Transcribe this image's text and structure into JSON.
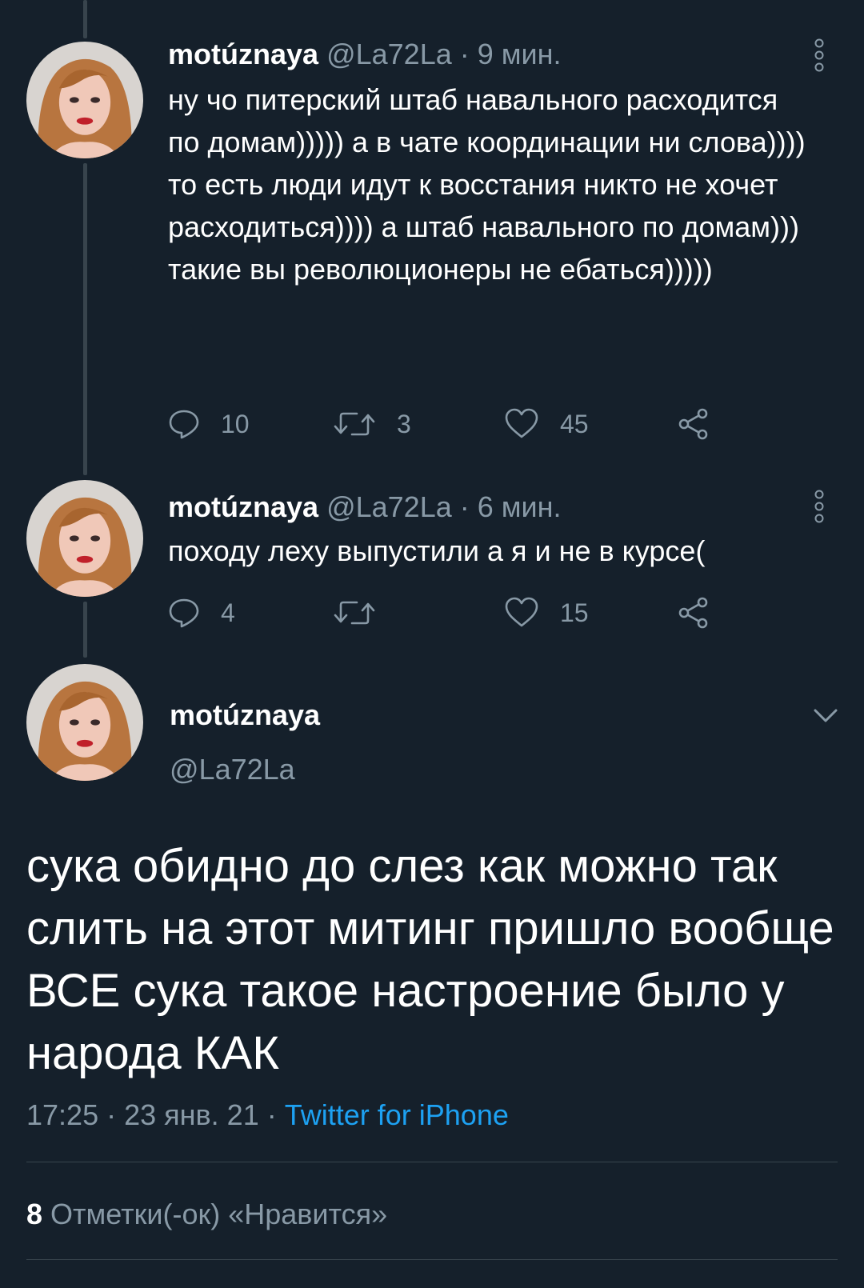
{
  "tweets": [
    {
      "name": "motúznaya",
      "handle": "@La72La",
      "separator": "·",
      "time": "9 мин.",
      "text": "ну чо питерский штаб навального расходится по домам))))) а в чате координации ни слова)))) то есть люди идут к восстания никто не хочет расходиться)))) а штаб навального по домам))) такие вы революционеры не ебаться)))))",
      "reply_count": "10",
      "retweet_count": "3",
      "like_count": "45"
    },
    {
      "name": "motúznaya",
      "handle": "@La72La",
      "separator": "·",
      "time": "6 мин.",
      "text": "походу леху выпустили а я и не в курсе(",
      "reply_count": "4",
      "retweet_count": "",
      "like_count": "15"
    }
  ],
  "main_tweet": {
    "name": "motúznaya",
    "handle": "@La72La",
    "text": "сука обидно до слез как можно так слить на этот митинг пришло вообще ВСЕ сука такое настроение было у народа КАК",
    "time": "17:25",
    "separator": "·",
    "date": "23 янв. 21",
    "source": "Twitter for iPhone",
    "likes_count": "8",
    "likes_label": "Отметки(-ок) «Нравится»"
  },
  "colors": {
    "background": "#15202b",
    "text": "#ffffff",
    "muted": "#8899a6",
    "accent": "#1da1f2",
    "divider": "#38444d"
  },
  "icons": [
    "more-vertical-icon",
    "reply-icon",
    "retweet-icon",
    "like-icon",
    "share-icon",
    "chevron-down-icon",
    "avatar"
  ]
}
